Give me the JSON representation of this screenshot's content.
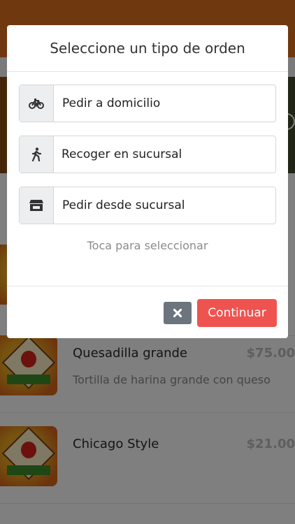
{
  "modal": {
    "title": "Seleccione un tipo de orden",
    "options": [
      {
        "label": "Pedir a domicilio",
        "icon": "bicycle-icon"
      },
      {
        "label": "Recoger en sucursal",
        "icon": "walking-icon"
      },
      {
        "label": "Pedir desde sucursal",
        "icon": "store-icon"
      }
    ],
    "hint": "Toca para seleccionar",
    "close_icon": "close-icon",
    "continue_label": "Continuar"
  },
  "menu": {
    "items": [
      {
        "name": "Quesadilla grande",
        "price": "$75.00",
        "description": "Tortilla de harina grande con queso"
      },
      {
        "name": "Chicago Style",
        "price": "$21.00",
        "description": ""
      }
    ]
  },
  "colors": {
    "header": "#e0701f",
    "continue_button": "#ef5350",
    "close_button": "#6c757d"
  }
}
